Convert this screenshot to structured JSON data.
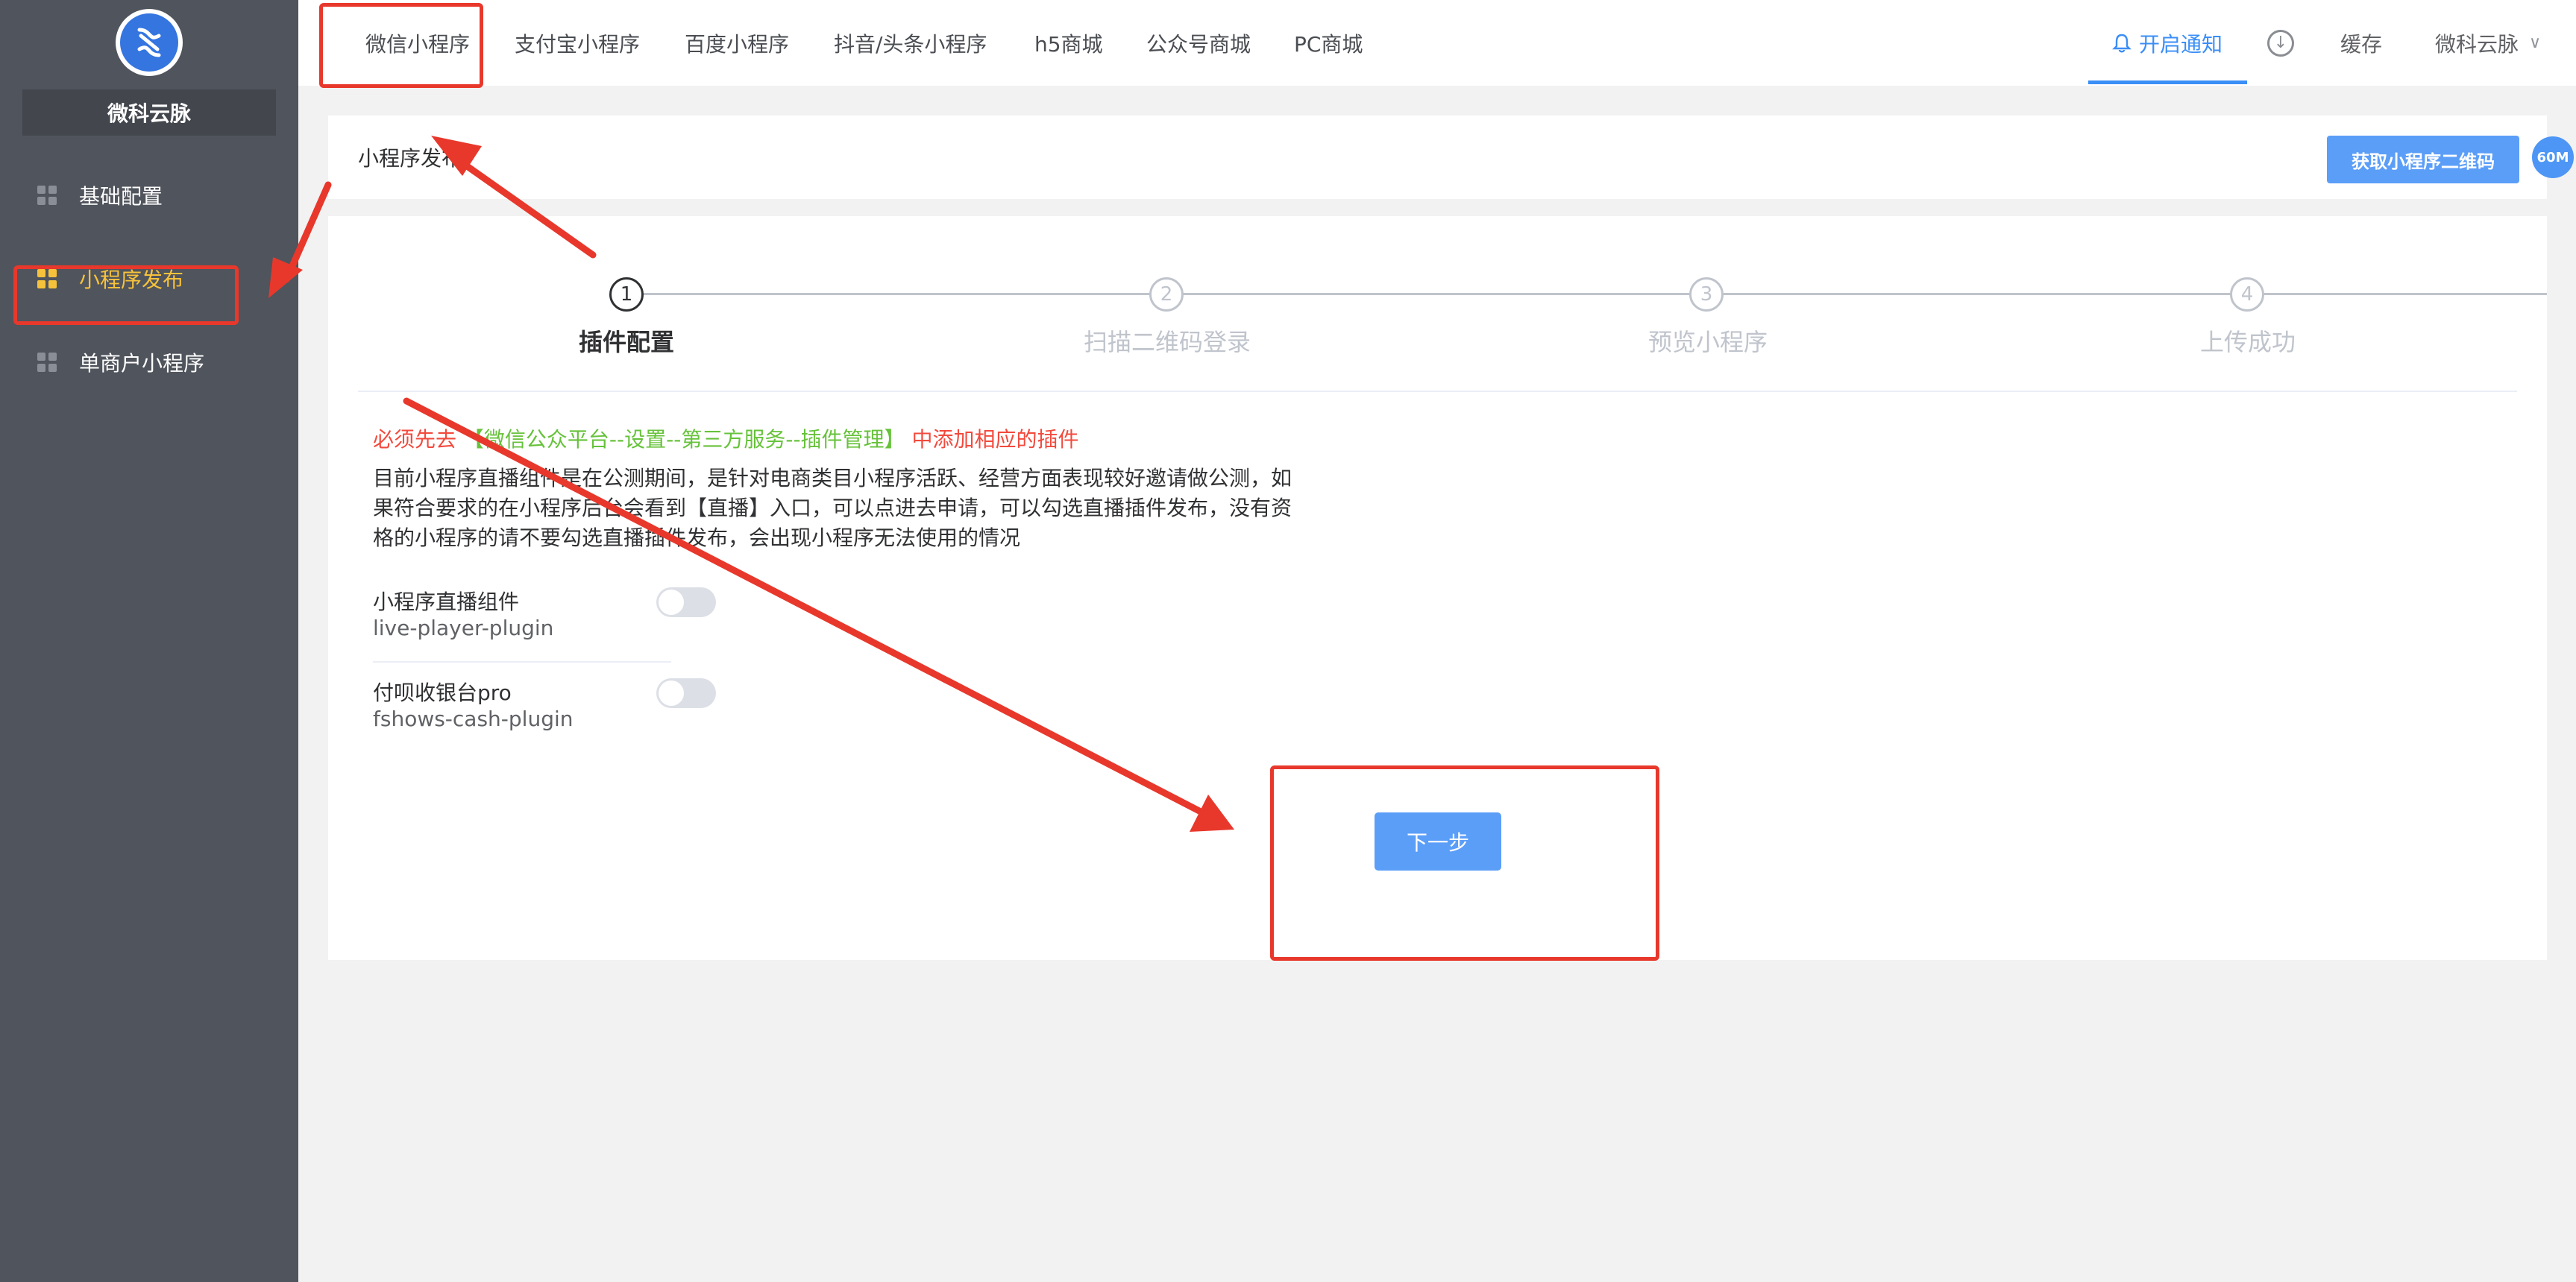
{
  "sidebar": {
    "brand": "微科云脉",
    "items": [
      {
        "label": "基础配置",
        "icon": "grid-icon"
      },
      {
        "label": "小程序发布",
        "icon": "grid-icon"
      },
      {
        "label": "单商户小程序",
        "icon": "grid-icon"
      }
    ]
  },
  "topbar": {
    "tabs": [
      "微信小程序",
      "支付宝小程序",
      "百度小程序",
      "抖音/头条小程序",
      "h5商城",
      "公众号商城",
      "PC商城"
    ],
    "notify_label": "开启通知",
    "cache_label": "缓存",
    "user_label": "微科云脉"
  },
  "header": {
    "title": "小程序发布",
    "qr_button": "获取小程序二维码",
    "badge": "60M"
  },
  "steps": [
    {
      "num": "1",
      "label": "插件配置"
    },
    {
      "num": "2",
      "label": "扫描二维码登录"
    },
    {
      "num": "3",
      "label": "预览小程序"
    },
    {
      "num": "4",
      "label": "上传成功"
    }
  ],
  "notice": {
    "prefix": "必须先去",
    "link": "【微信公众平台--设置--第三方服务--插件管理】",
    "suffix": "中添加相应的插件"
  },
  "description": {
    "line1": "目前小程序直播组件是在公测期间，是针对电商类目小程序活跃、经营方面表现较好邀请做公测，如",
    "line2": "果符合要求的在小程序后台会看到【直播】入口，可以点进去申请，可以勾选直播插件发布，没有资",
    "line3": "格的小程序的请不要勾选直播插件发布，会出现小程序无法使用的情况"
  },
  "plugins": [
    {
      "name": "小程序直播组件",
      "id": "live-player-plugin",
      "enabled": false
    },
    {
      "name": "付呗收银台pro",
      "id": "fshows-cash-plugin",
      "enabled": false
    }
  ],
  "next_button": "下一步",
  "colors": {
    "sidebar_bg": "#50545c",
    "active_nav": "#f7c23b",
    "primary": "#5b9ef8",
    "notice_red": "#f24a3d",
    "notice_green": "#66c23a",
    "annotation_red": "#e8382c"
  }
}
